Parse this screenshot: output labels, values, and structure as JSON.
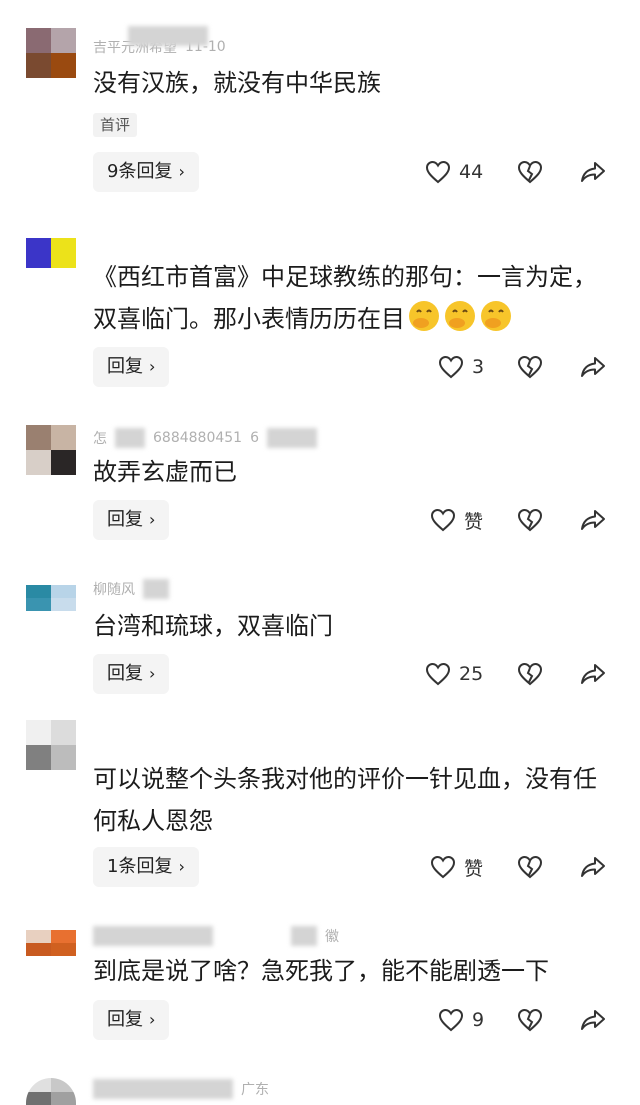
{
  "comments": [
    {
      "meta_name": "吉平元洲希望",
      "meta_time": "11-10",
      "text": "没有汉族，就没有中华民族",
      "tag": "首评",
      "reply_label": "9条回复",
      "likes": "44",
      "avatar_colors": [
        "#8a6a72",
        "#b4a4aa",
        "#7a4a30",
        "#9a4a10"
      ]
    },
    {
      "meta_name": "",
      "meta_time": "",
      "text": "《西红市首富》中足球教练的那句：一言为定，双喜临门。那小表情历历在目",
      "reply_label": "回复",
      "likes": "3",
      "emoji_count": 3,
      "avatar_colors": [
        "#3b35c8",
        "#ece21a",
        "#3b35c8",
        "#ece21a"
      ]
    },
    {
      "meta_name": "怎",
      "meta_time": "6884880451",
      "meta_extra": "6",
      "text": "故弄玄虚而已",
      "reply_label": "回复",
      "likes": "赞",
      "avatar_colors": [
        "#9a8070",
        "#c8b4a4",
        "#d8cfc8",
        "#2a2626"
      ]
    },
    {
      "meta_name": "柳随风",
      "meta_time": "",
      "text": "台湾和琉球，双喜临门",
      "reply_label": "回复",
      "likes": "25",
      "avatar_colors": [
        "#2a8aa4",
        "#b8d4e8",
        "#3a94b0",
        "#c8dcec"
      ]
    },
    {
      "meta_name": "",
      "meta_time": "",
      "text": "可以说整个头条我对他的评价一针见血，没有任何私人恩怨",
      "reply_label": "1条回复",
      "likes": "赞",
      "avatar_colors": [
        "#f0f0f0",
        "#dcdcdc",
        "#808080",
        "#bcbcbc"
      ]
    },
    {
      "meta_name": "",
      "meta_time": "徽",
      "text": "到底是说了啥？急死我了，能不能剧透一下",
      "reply_label": "回复",
      "likes": "9",
      "avatar_colors": [
        "#e8d0c0",
        "#e87030",
        "#c85a20",
        "#d06020"
      ]
    },
    {
      "meta_name": "广东",
      "meta_time": "",
      "text": "",
      "avatar_colors": [
        "#e0e0e0",
        "#c8c8c8",
        "#707070",
        "#a0a0a0"
      ]
    }
  ],
  "icons": {
    "like": "heart-outline-icon",
    "dislike": "broken-heart-icon",
    "share": "share-arrow-icon",
    "emoji": "face-hand-over-mouth-emoji"
  },
  "colors": {
    "text": "#1c1c1c",
    "button_bg": "#f4f4f4",
    "icon": "#333333"
  }
}
